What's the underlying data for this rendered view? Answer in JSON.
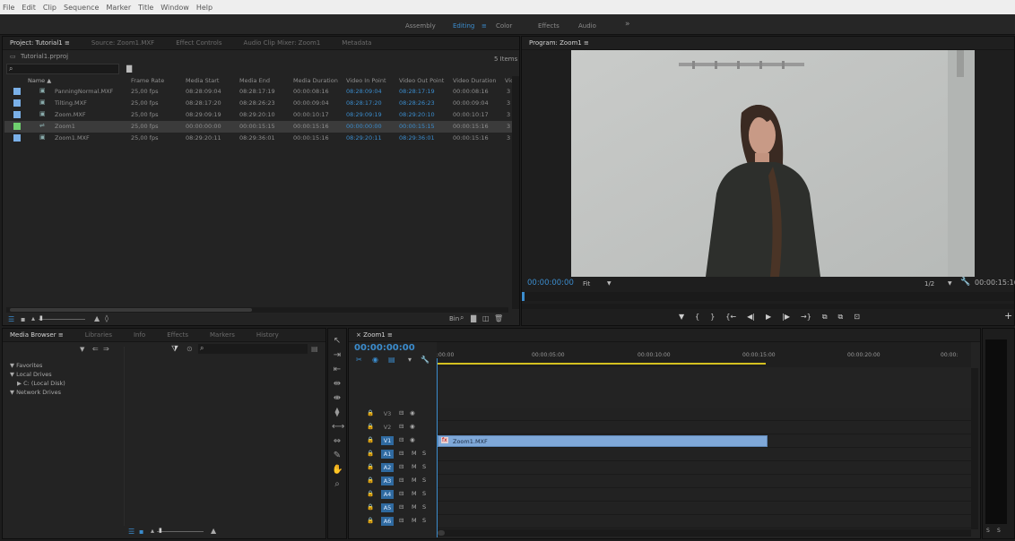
{
  "menu": [
    "File",
    "Edit",
    "Clip",
    "Sequence",
    "Marker",
    "Title",
    "Window",
    "Help"
  ],
  "workspaces": {
    "items": [
      "Assembly",
      "Editing",
      "Color",
      "Effects",
      "Audio"
    ],
    "active": "Editing",
    "more": "»",
    "menu_glyph": "≡"
  },
  "project_panel": {
    "tabs": [
      "Project: Tutorial1",
      "Source: Zoom1.MXF",
      "Effect Controls",
      "Audio Clip Mixer: Zoom1",
      "Metadata"
    ],
    "tab_menu_glyph": "≡",
    "file": "Tutorial1.prproj",
    "search_placeholder": "",
    "item_count": "5 Items",
    "columns": [
      "Name",
      "Frame Rate",
      "Media Start",
      "Media End",
      "Media Duration",
      "Video In Point",
      "Video Out Point",
      "Video Duration",
      "Vide"
    ],
    "sort_glyph": "▲",
    "rows": [
      {
        "name": "PanningNormal.MXF",
        "fps": "25,00 fps",
        "start": "08:28:09:04",
        "end": "08:28:17:19",
        "dur": "00:00:08:16",
        "in": "08:28:09:04",
        "out": "08:28:17:19",
        "vdur": "00:00:08:16",
        "v": "3",
        "color": "#7ab0e8",
        "selected": false
      },
      {
        "name": "Tilting.MXF",
        "fps": "25,00 fps",
        "start": "08:28:17:20",
        "end": "08:28:26:23",
        "dur": "00:00:09:04",
        "in": "08:28:17:20",
        "out": "08:28:26:23",
        "vdur": "00:00:09:04",
        "v": "3",
        "color": "#7ab0e8",
        "selected": false
      },
      {
        "name": "Zoom.MXF",
        "fps": "25,00 fps",
        "start": "08:29:09:19",
        "end": "08:29:20:10",
        "dur": "00:00:10:17",
        "in": "08:29:09:19",
        "out": "08:29:20:10",
        "vdur": "00:00:10:17",
        "v": "3",
        "color": "#7ab0e8",
        "selected": false
      },
      {
        "name": "Zoom1",
        "fps": "25,00 fps",
        "start": "00:00:00:00",
        "end": "00:00:15:15",
        "dur": "00:00:15:16",
        "in": "00:00:00:00",
        "out": "00:00:15:15",
        "vdur": "00:00:15:16",
        "v": "3",
        "color": "#6fd06f",
        "selected": true
      },
      {
        "name": "Zoom1.MXF",
        "fps": "25,00 fps",
        "start": "08:29:20:11",
        "end": "08:29:36:01",
        "dur": "00:00:15:16",
        "in": "08:29:20:11",
        "out": "08:29:36:01",
        "vdur": "00:00:15:16",
        "v": "3",
        "color": "#7ab0e8",
        "selected": false
      }
    ],
    "bin_label": "Bin"
  },
  "program_monitor": {
    "tab": "Program: Zoom1",
    "timecode": "00:00:00:00",
    "fit": "Fit",
    "resolution": "1/2",
    "duration": "00:00:15:16",
    "transport": [
      "▼",
      "{",
      "}",
      "{←",
      "◀|",
      "▶",
      "|▶",
      "→}",
      "⧉",
      "⧉",
      "⊡"
    ],
    "plus": "+"
  },
  "media_browser": {
    "tabs": [
      "Media Browser",
      "Libraries",
      "Info",
      "Effects",
      "Markers",
      "History"
    ],
    "tree": [
      "▼ Favorites",
      "▼ Local Drives",
      "▶  C: (Local Disk)",
      "▼ Network Drives"
    ]
  },
  "timeline": {
    "tab": "Zoom1",
    "close": "×",
    "timecode": "00:00:00:00",
    "ruler": [
      ":00:00",
      "00:00:05:00",
      "00:00:10:00",
      "00:00:15:00",
      "00:00:20:00",
      "00:00:"
    ],
    "video_tracks": [
      "V3",
      "V2",
      "V1"
    ],
    "audio_tracks": [
      "A1",
      "A2",
      "A3",
      "A4",
      "A5",
      "A6"
    ],
    "clip": "Zoom1.MXF",
    "clip_fx": "fx",
    "m": "M",
    "s": "S"
  },
  "meter": {
    "labels": [
      "S",
      "S"
    ]
  },
  "colors": {
    "accent": "#3b8ccd",
    "clip": "#7fa8d8",
    "workarea": "#d4c020"
  }
}
